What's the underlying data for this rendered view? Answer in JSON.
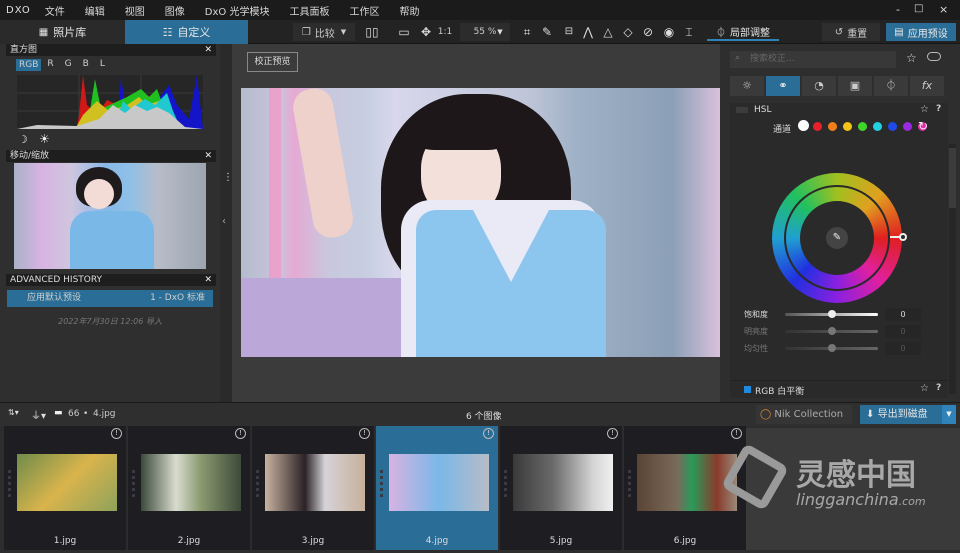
{
  "app": {
    "logo": "DXO",
    "menu": [
      "文件",
      "编辑",
      "视图",
      "图像",
      "DxO 光学模块",
      "工具面板",
      "工作区",
      "帮助"
    ],
    "window_controls": {
      "minimize": "-",
      "maximize": "□",
      "close": "×"
    }
  },
  "toolbar": {
    "tab_library": "照片库",
    "tab_customize": "自定义",
    "compare_label": "比较",
    "zoom_1to1": "1:1",
    "zoom_value": "55 %",
    "local_adjust_label": "局部调整",
    "reset_label": "重置",
    "apply_preset_label": "应用预设",
    "icons": [
      "crop-icon",
      "eyedropper-icon",
      "horizon-icon",
      "perspective-icon",
      "perspective-rect-icon",
      "perspective-quad-icon",
      "repair-icon",
      "red-eye-icon",
      "moire-icon"
    ]
  },
  "histogram": {
    "title": "直方图",
    "channels": [
      "RGB",
      "R",
      "G",
      "B",
      "L"
    ],
    "active_channel": "RGB",
    "shadow_icon": "moon-icon",
    "highlight_icon": "sun-icon"
  },
  "navigator": {
    "title": "移动/缩放"
  },
  "history": {
    "title": "ADVANCED HISTORY",
    "entries": [
      {
        "label": "应用默认预设",
        "preset": "1 - DxO 标准"
      }
    ],
    "timestamp": "2022年7月30日 12:06 导入"
  },
  "viewer": {
    "preview_label": "校正预览"
  },
  "right_panel": {
    "search_placeholder": "搜索校正...",
    "tabs": [
      "light-icon",
      "color-icon",
      "detail-icon",
      "geometry-icon",
      "local-icon",
      "effects-icon"
    ],
    "hsl": {
      "title": "HSL",
      "channel_label": "通道",
      "channels": [
        {
          "name": "all",
          "color": "#ffffff"
        },
        {
          "name": "red",
          "color": "#e8202a"
        },
        {
          "name": "orange",
          "color": "#f07f1a"
        },
        {
          "name": "yellow",
          "color": "#f0c21a"
        },
        {
          "name": "green",
          "color": "#3fd42a"
        },
        {
          "name": "cyan",
          "color": "#22d0e0"
        },
        {
          "name": "blue",
          "color": "#1f4ae8"
        },
        {
          "name": "purple",
          "color": "#9a2ae0"
        },
        {
          "name": "magenta",
          "color": "#e02aa8"
        }
      ],
      "sliders": [
        {
          "label": "饱和度",
          "value": "0",
          "position": 0.5,
          "enabled": true
        },
        {
          "label": "明亮度",
          "value": "0",
          "position": 0.5,
          "enabled": false
        },
        {
          "label": "均匀性",
          "value": "0",
          "position": 0.5,
          "enabled": false
        }
      ]
    },
    "rgb_wb": {
      "title": "RGB 白平衡"
    }
  },
  "filmstrip_bar": {
    "folder_count": "66",
    "current_file": "4.jpg",
    "image_count": "6 个图像",
    "nik_label": "Nik Collection",
    "export_label": "导出到磁盘"
  },
  "filmstrip": {
    "items": [
      {
        "name": "1.jpg",
        "selected": false
      },
      {
        "name": "2.jpg",
        "selected": false
      },
      {
        "name": "3.jpg",
        "selected": false
      },
      {
        "name": "4.jpg",
        "selected": true
      },
      {
        "name": "5.jpg",
        "selected": false
      },
      {
        "name": "6.jpg",
        "selected": false
      }
    ]
  },
  "watermark": {
    "cn": "灵感中国",
    "en": "lingganchina",
    "tld": ".com"
  },
  "colors": {
    "accent": "#2a6d96",
    "accent_light": "#2f83b8"
  }
}
